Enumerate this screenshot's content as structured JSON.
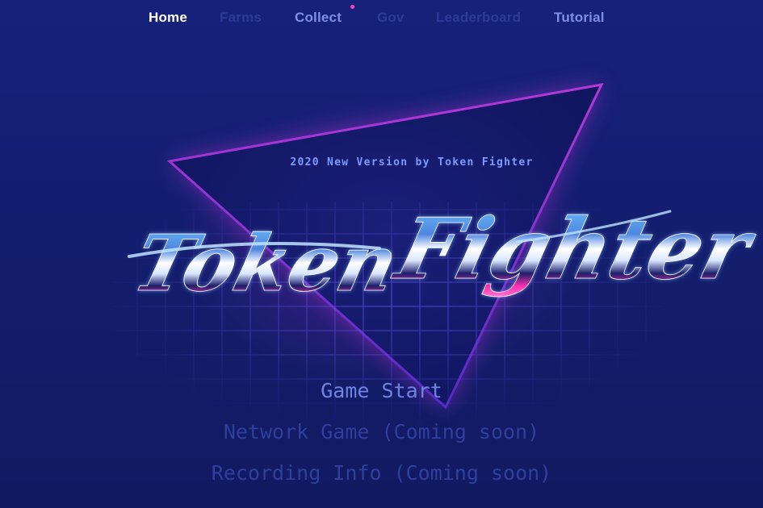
{
  "nav": {
    "items": [
      {
        "label": "Home"
      },
      {
        "label": "Farms"
      },
      {
        "label": "Collect"
      },
      {
        "label": "Gov"
      },
      {
        "label": "Leaderboard"
      },
      {
        "label": "Tutorial"
      }
    ]
  },
  "logo": {
    "tagline": "2020 New Version by Token Fighter",
    "title_word1": "Token",
    "title_word2": "Fighter"
  },
  "menu": {
    "game_start": "Game Start",
    "network_game": "Network Game (Coming soon)",
    "recording_info": "Recording Info (Coming soon)"
  },
  "colors": {
    "background": "#141f6c",
    "nav_active": "#ffffff",
    "nav_enabled": "#7d8fe6",
    "nav_disabled": "#2c3b9a",
    "menu_active": "#6f84e2",
    "menu_disabled": "#2f3f9e",
    "accent_pink": "#ff3fbf",
    "accent_blue": "#6ec8ff"
  }
}
